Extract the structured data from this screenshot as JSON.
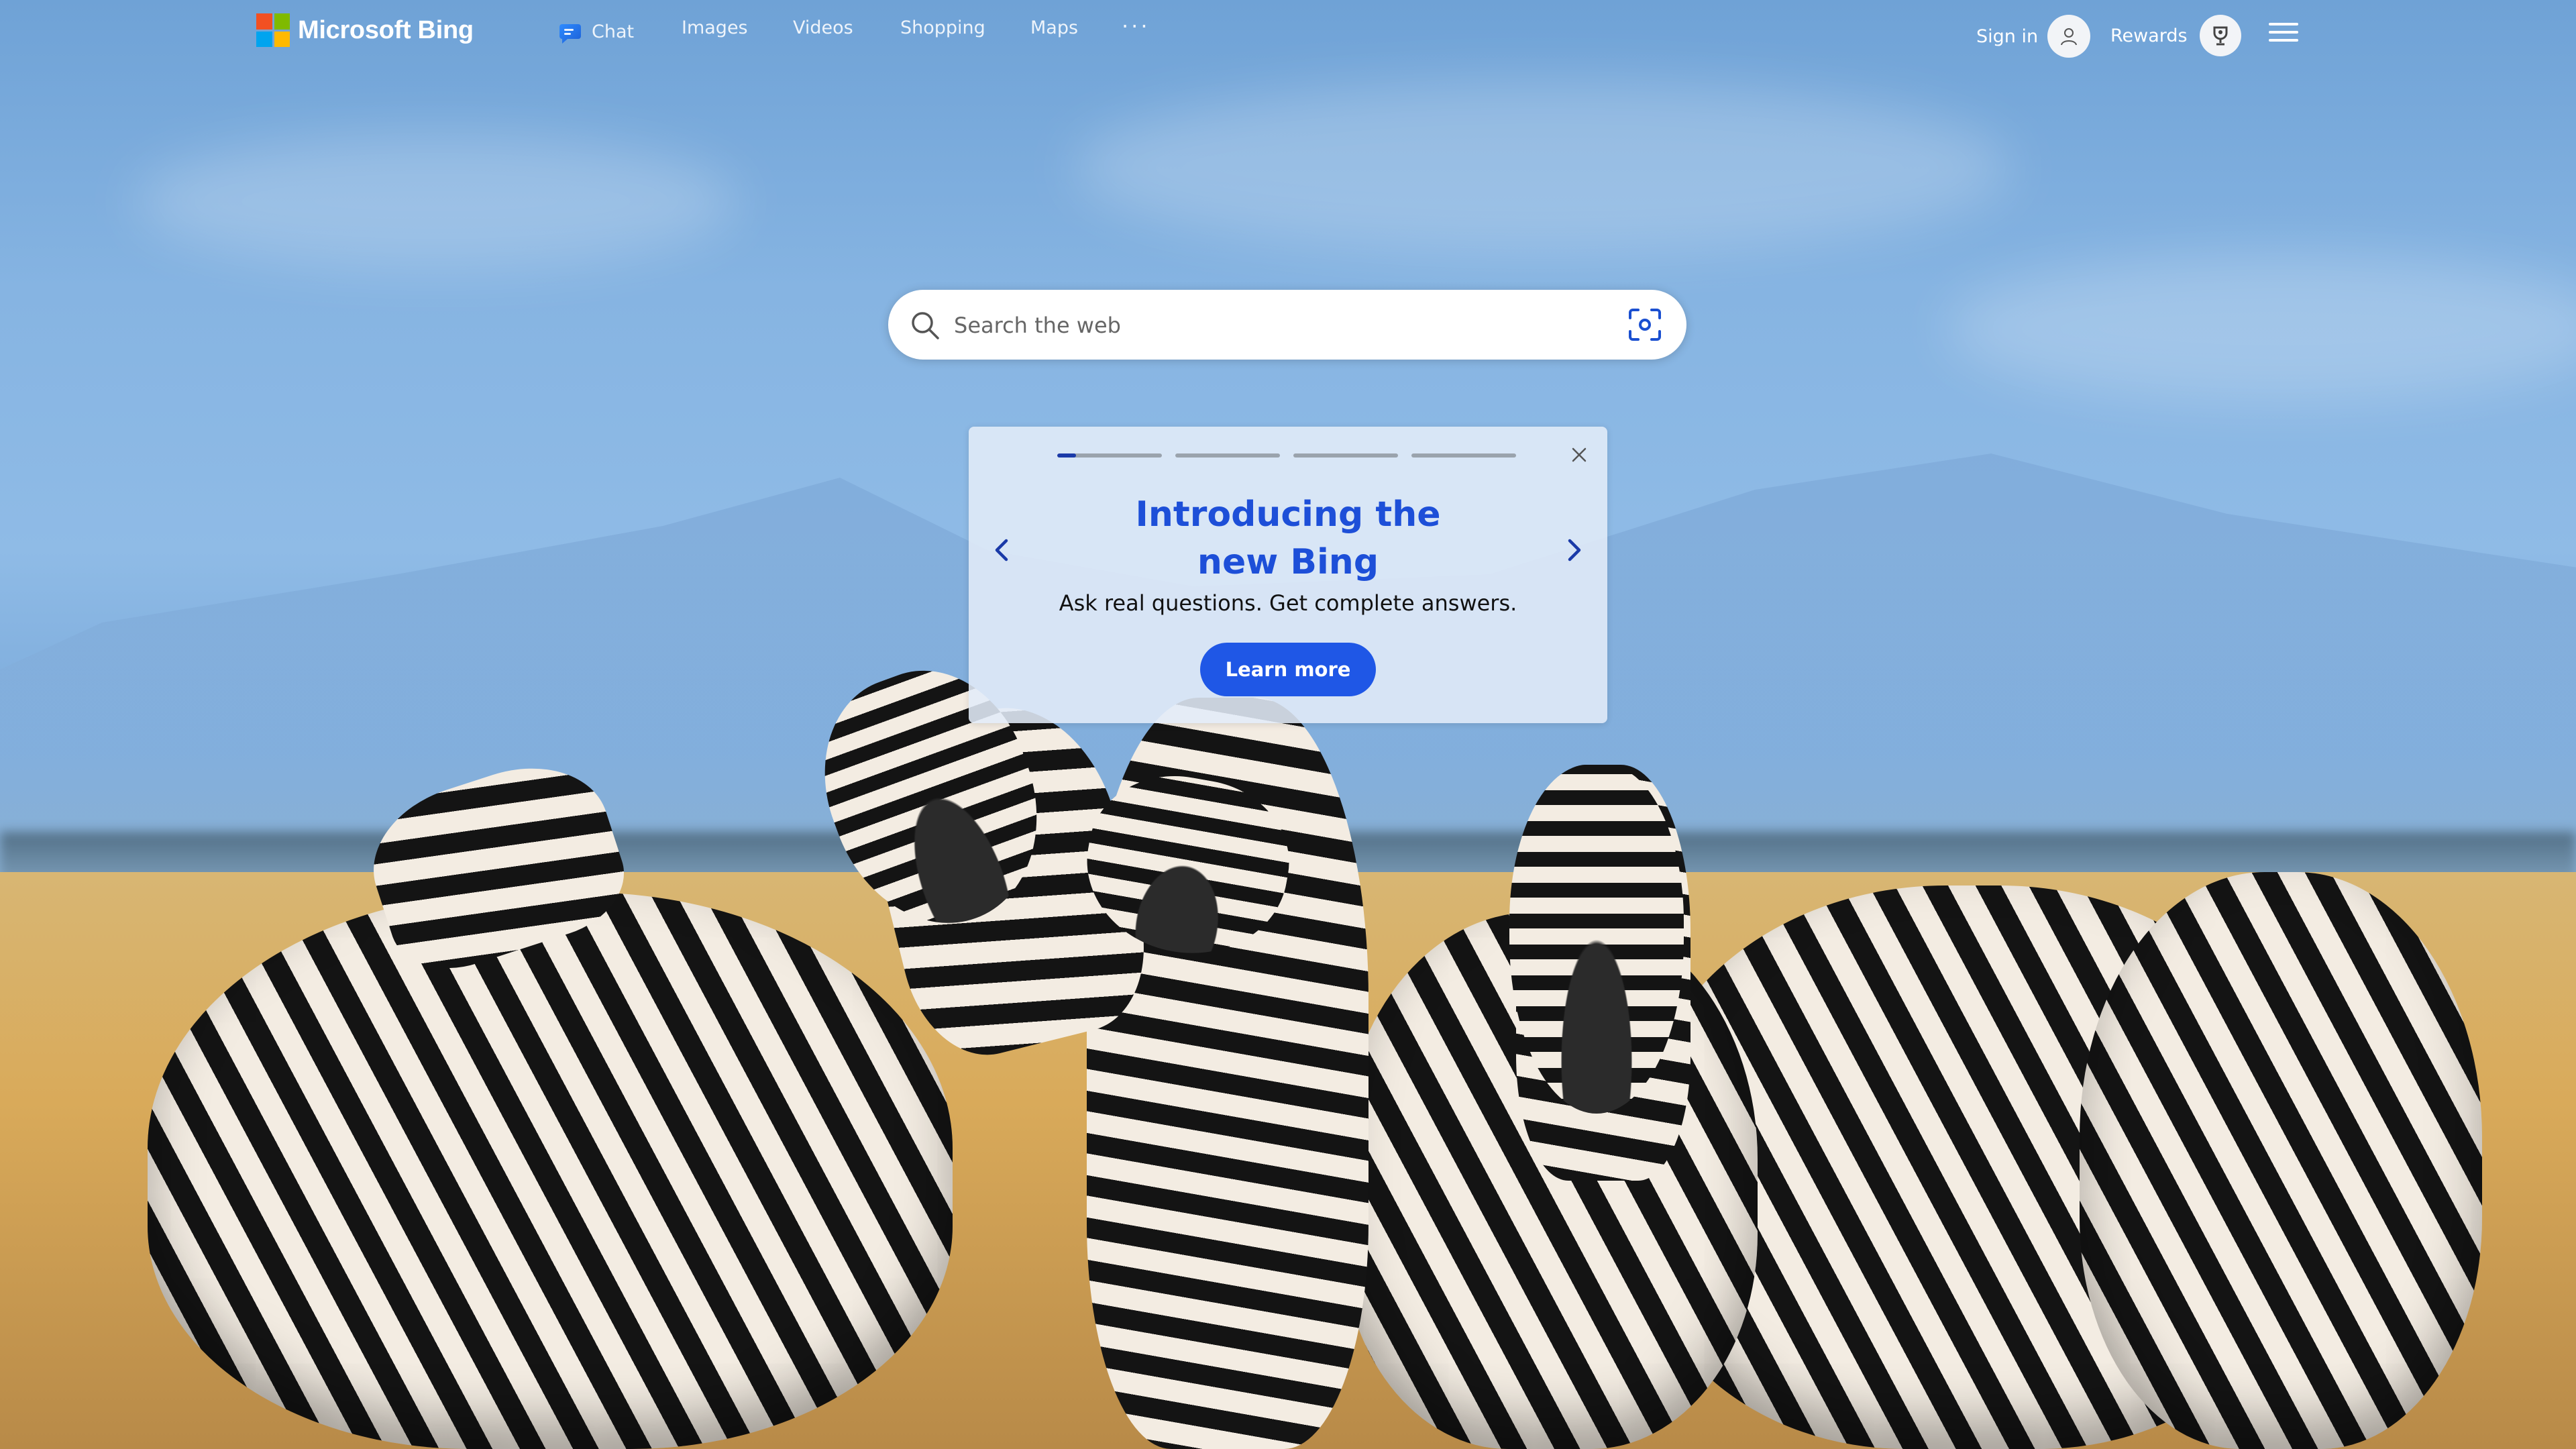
{
  "header": {
    "brand": "Microsoft Bing",
    "nav": {
      "chat": "Chat",
      "images": "Images",
      "videos": "Videos",
      "shopping": "Shopping",
      "maps": "Maps",
      "more": "···"
    },
    "sign_in": "Sign in",
    "rewards": "Rewards"
  },
  "search": {
    "placeholder": "Search the web",
    "value": ""
  },
  "promo": {
    "title": "Introducing the new Bing",
    "subtitle": "Ask real questions. Get complete answers.",
    "cta": "Learn more",
    "slide_count": 4,
    "active_slide": 1,
    "active_slide_progress": 0.18
  },
  "colors": {
    "accent": "#1f57e6",
    "title_blue": "#1d4fd8",
    "logo_red": "#f25022",
    "logo_green": "#7fba00",
    "logo_blue": "#00a4ef",
    "logo_yellow": "#ffb900"
  },
  "icons": {
    "chat": "copilot-chat-icon",
    "search": "search-icon",
    "visual_search": "visual-search-icon",
    "avatar": "user-avatar-icon",
    "rewards": "rewards-trophy-icon",
    "menu": "hamburger-menu-icon",
    "close": "close-icon",
    "prev": "chevron-left-icon",
    "next": "chevron-right-icon"
  }
}
